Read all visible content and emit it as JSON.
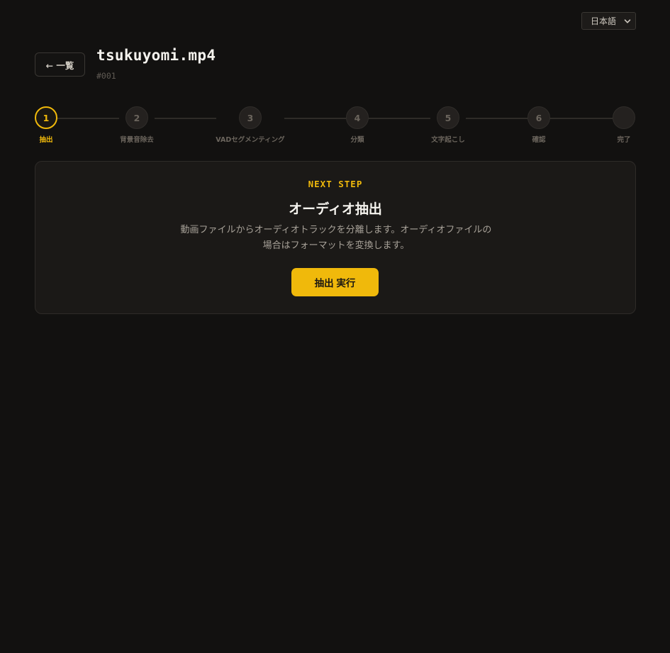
{
  "language": {
    "selected": "日本語"
  },
  "header": {
    "back_label": "← 一覧",
    "file_title": "tsukuyomi.mp4",
    "file_id": "#001"
  },
  "steps": [
    {
      "number": "1",
      "label": "抽出",
      "status": "active"
    },
    {
      "number": "2",
      "label": "背景音除去",
      "status": "pending"
    },
    {
      "number": "3",
      "label": "VADセグメンティング",
      "status": "pending"
    },
    {
      "number": "4",
      "label": "分類",
      "status": "pending"
    },
    {
      "number": "5",
      "label": "文字起こし",
      "status": "pending"
    },
    {
      "number": "6",
      "label": "確認",
      "status": "pending"
    },
    {
      "number": "",
      "label": "完了",
      "status": "pending"
    }
  ],
  "card": {
    "eyebrow": "NEXT STEP",
    "title": "オーディオ抽出",
    "description": "動画ファイルからオーディオトラックを分離します。オーディオファイルの場合はフォーマットを変換します。",
    "run_label": "抽出 実行"
  },
  "colors": {
    "accent": "#f0b90b",
    "background": "#121110",
    "card": "#1b1917"
  }
}
